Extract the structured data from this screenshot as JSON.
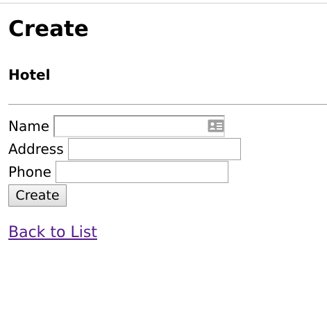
{
  "page": {
    "title": "Create",
    "subtitle": "Hotel"
  },
  "form": {
    "fields": [
      {
        "label": "Name",
        "value": "",
        "icon": "contact-card-icon"
      },
      {
        "label": "Address",
        "value": ""
      },
      {
        "label": "Phone",
        "value": ""
      }
    ],
    "submit_label": "Create"
  },
  "nav": {
    "back_label": "Back to List"
  },
  "colors": {
    "link_visited": "#551a8b",
    "rule": "#9a9a9a"
  }
}
